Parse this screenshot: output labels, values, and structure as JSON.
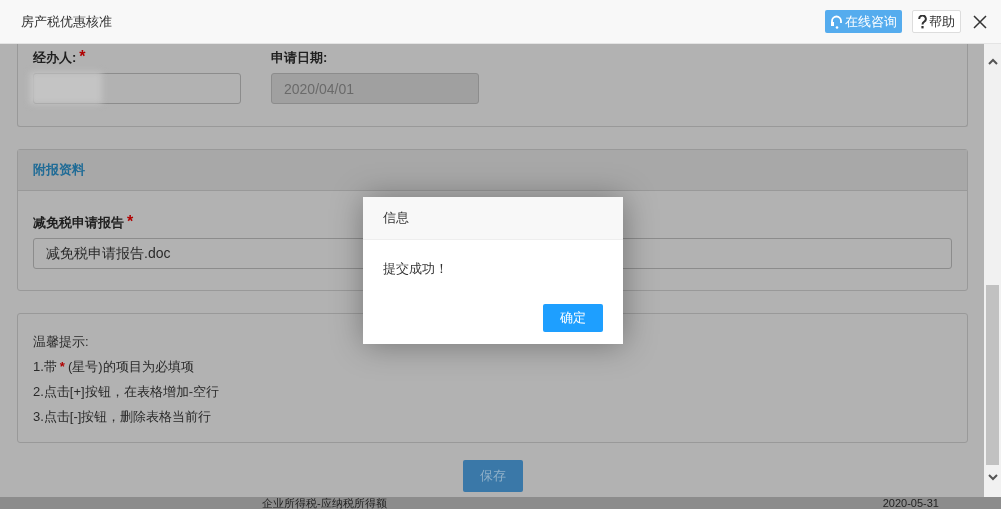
{
  "window": {
    "title": "房产税优惠核准",
    "consult_button": "在线咨询",
    "help_button": "帮助"
  },
  "applicant_fields": [
    {
      "kind": "redacted",
      "label": "经办人:",
      "required_mark": "*",
      "disabled": false
    },
    {
      "kind": "text",
      "label": "申请日期:",
      "value": "2020/04/01",
      "disabled": true
    }
  ],
  "attachments": {
    "title": "附报资料",
    "fields": [
      {
        "label": "减免税申请报告",
        "required_mark": "*",
        "value": "减免税申请报告.doc"
      }
    ]
  },
  "tips": {
    "title": "温馨提示:",
    "lines": [
      {
        "before": "1.带",
        "mark": "*",
        "after": "(星号)的项目为必填项"
      },
      {
        "before": "2.点击[+]按钮，在表格增加-空行"
      },
      {
        "before": "3.点击[-]按钮，删除表格当前行"
      }
    ]
  },
  "save_button": "保存",
  "background_row": {
    "cells": [
      "企业所得税-应纳税所得额",
      "2020-05-31"
    ]
  },
  "message_dialog": {
    "title": "信息",
    "message": "提交成功！",
    "button": "确定"
  }
}
